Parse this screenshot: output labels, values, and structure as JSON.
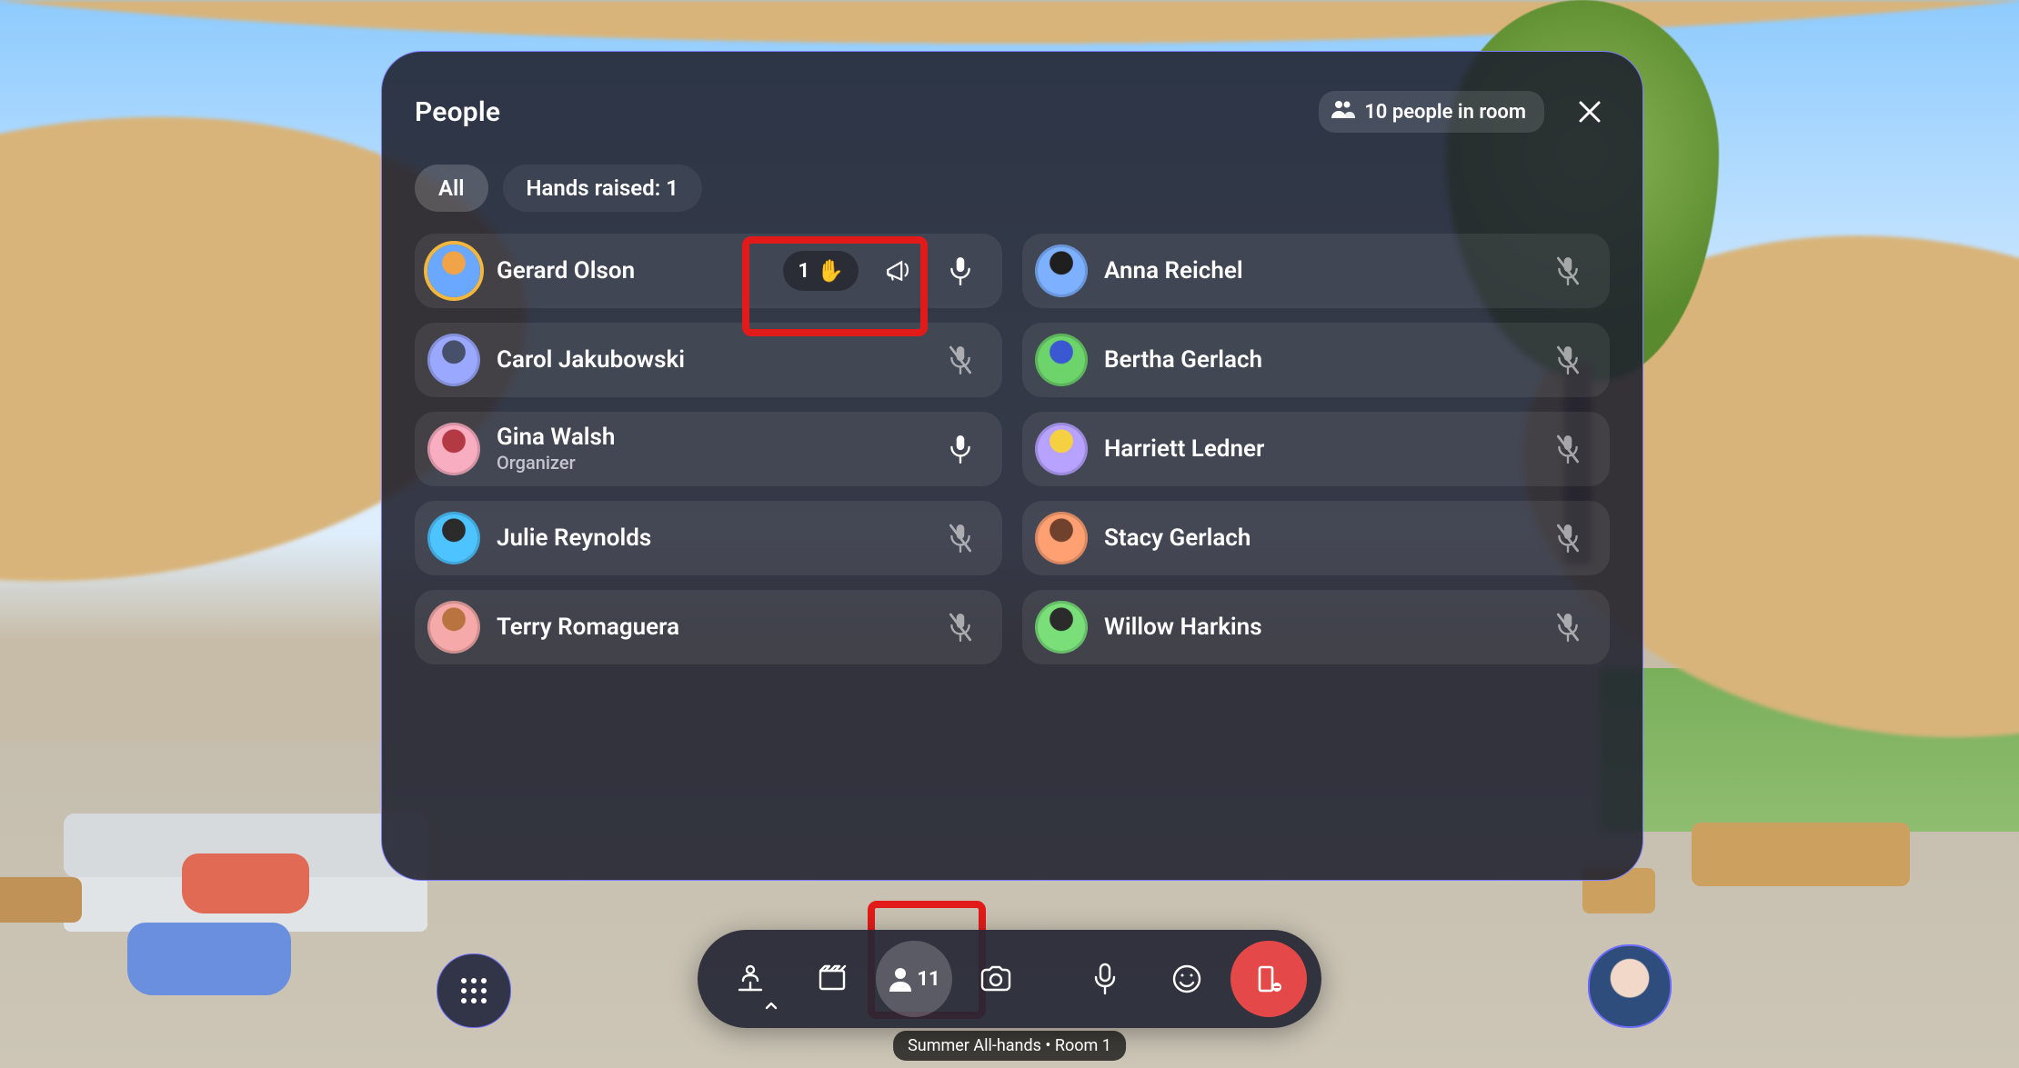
{
  "header": {
    "title": "People",
    "room_badge": "10 people in room"
  },
  "tabs": {
    "all_label": "All",
    "hands_raised_label": "Hands raised: 1"
  },
  "people": {
    "left": [
      {
        "name": "Gerard Olson",
        "subtitle": "",
        "avatarColor1": "#6aa8ff",
        "avatarColor2": "#f0a447",
        "ring": true,
        "handOrder": "1",
        "hasMegaphone": true,
        "mic": "on"
      },
      {
        "name": "Carol Jakubowski",
        "subtitle": "",
        "avatarColor1": "#9aa9ff",
        "avatarColor2": "#47506b",
        "mic": "muted"
      },
      {
        "name": "Gina Walsh",
        "subtitle": "Organizer",
        "avatarColor1": "#f9adc1",
        "avatarColor2": "#b33a44",
        "mic": "on"
      },
      {
        "name": "Julie Reynolds",
        "subtitle": "",
        "avatarColor1": "#4dc3ff",
        "avatarColor2": "#2b2b2b",
        "mic": "muted"
      },
      {
        "name": "Terry Romaguera",
        "subtitle": "",
        "avatarColor1": "#f5a9a9",
        "avatarColor2": "#b97341",
        "mic": "muted"
      }
    ],
    "right": [
      {
        "name": "Anna Reichel",
        "subtitle": "",
        "avatarColor1": "#7db1ff",
        "avatarColor2": "#1f1f1f",
        "mic": "muted"
      },
      {
        "name": "Bertha Gerlach",
        "subtitle": "",
        "avatarColor1": "#6cd46a",
        "avatarColor2": "#3a58d1",
        "mic": "muted"
      },
      {
        "name": "Harriett Ledner",
        "subtitle": "",
        "avatarColor1": "#b7a2ff",
        "avatarColor2": "#f5d141",
        "mic": "muted"
      },
      {
        "name": "Stacy Gerlach",
        "subtitle": "",
        "avatarColor1": "#ffa072",
        "avatarColor2": "#70412c",
        "mic": "muted"
      },
      {
        "name": "Willow Harkins",
        "subtitle": "",
        "avatarColor1": "#7adf79",
        "avatarColor2": "#2b2b2b",
        "mic": "muted"
      }
    ]
  },
  "toolbar": {
    "people_count": "11"
  },
  "room_label": "Summer All-hands • Room 1",
  "colors": {
    "highlight": "#e21a1a",
    "panelBorder": "#7c7cff",
    "exit": "#e54848"
  }
}
